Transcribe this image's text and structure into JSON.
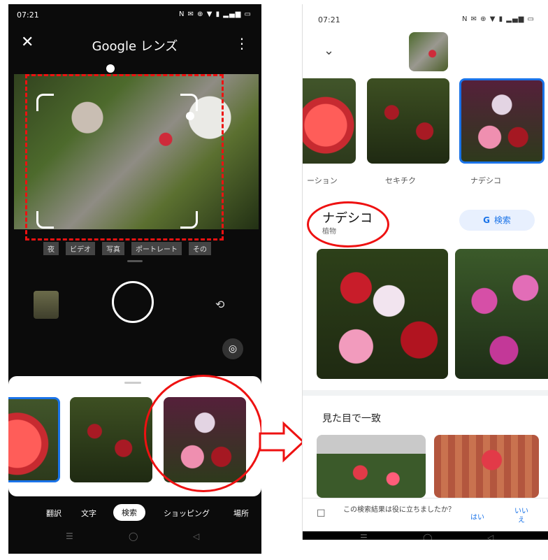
{
  "left": {
    "status_time": "07:21",
    "status_icons": "N ✉ ⊕ ▼ ▮ ▂▄▆ ▭",
    "close_glyph": "✕",
    "title": "Google レンズ",
    "more_glyph": "⋮",
    "modes": [
      "夜",
      "ビデオ",
      "写真",
      "ポートレート",
      "その"
    ],
    "tabs": [
      "翻訳",
      "文字",
      "検索",
      "ショッピング",
      "場所"
    ],
    "active_tab": "検索",
    "nav": [
      "☰",
      "◯",
      "◁"
    ],
    "icons": {
      "flip": "⟲",
      "lens": "◎"
    }
  },
  "right": {
    "status_time": "07:21",
    "status_icons": "N ✉ ⊕ ▼ ▮ ▂▄▆ ▭",
    "chevron": "⌄",
    "thumb_labels": [
      "ーション",
      "セキチク",
      "ナデシコ"
    ],
    "result_title": "ナデシコ",
    "result_sub": "植物",
    "search_g": "G",
    "search_label": "検索",
    "section_title": "見た目で一致",
    "feedback_question": "この検索結果は役に立ちましたか？",
    "feedback_yes": "はい",
    "feedback_no": "いいえ",
    "nav": [
      "☰",
      "◯",
      "◁"
    ]
  },
  "colors": {
    "accent": "#1a73e8",
    "annotation": "#e11111"
  }
}
